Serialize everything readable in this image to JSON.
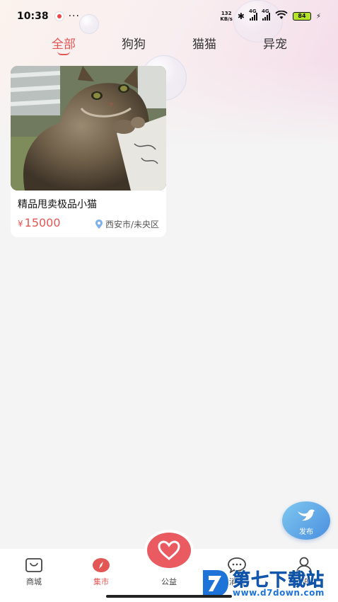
{
  "status_bar": {
    "time": "10:38",
    "more": "···",
    "net_speed_value": "132",
    "net_speed_unit": "KB/s",
    "signal_label_1": "4G",
    "signal_label_2": "4G",
    "battery": "84"
  },
  "tabs": [
    {
      "label": "全部",
      "active": true
    },
    {
      "label": "狗狗",
      "active": false
    },
    {
      "label": "猫猫",
      "active": false
    },
    {
      "label": "异宠",
      "active": false
    }
  ],
  "listings": [
    {
      "title": "精品甩卖极品小猫",
      "currency": "¥",
      "price": "15000",
      "location": "西安市/未央区",
      "image": "kitten-photo"
    }
  ],
  "fab": {
    "label": "发布",
    "icon": "bird-icon"
  },
  "bottom_nav": [
    {
      "label": "商城",
      "icon": "shop-bag-icon",
      "active": false
    },
    {
      "label": "集市",
      "icon": "compass-icon",
      "active": true
    },
    {
      "label": "公益",
      "icon": "heart-icon",
      "active": false
    },
    {
      "label": "消息",
      "icon": "chat-bubble-icon",
      "active": false
    },
    {
      "label": "我的",
      "icon": "user-icon",
      "active": false
    }
  ],
  "watermark": {
    "title": "第七下载站",
    "url": "www.d7down.com"
  },
  "colors": {
    "accent": "#e35656",
    "fab": "#4a8fdf",
    "center_button": "#e95b60"
  }
}
